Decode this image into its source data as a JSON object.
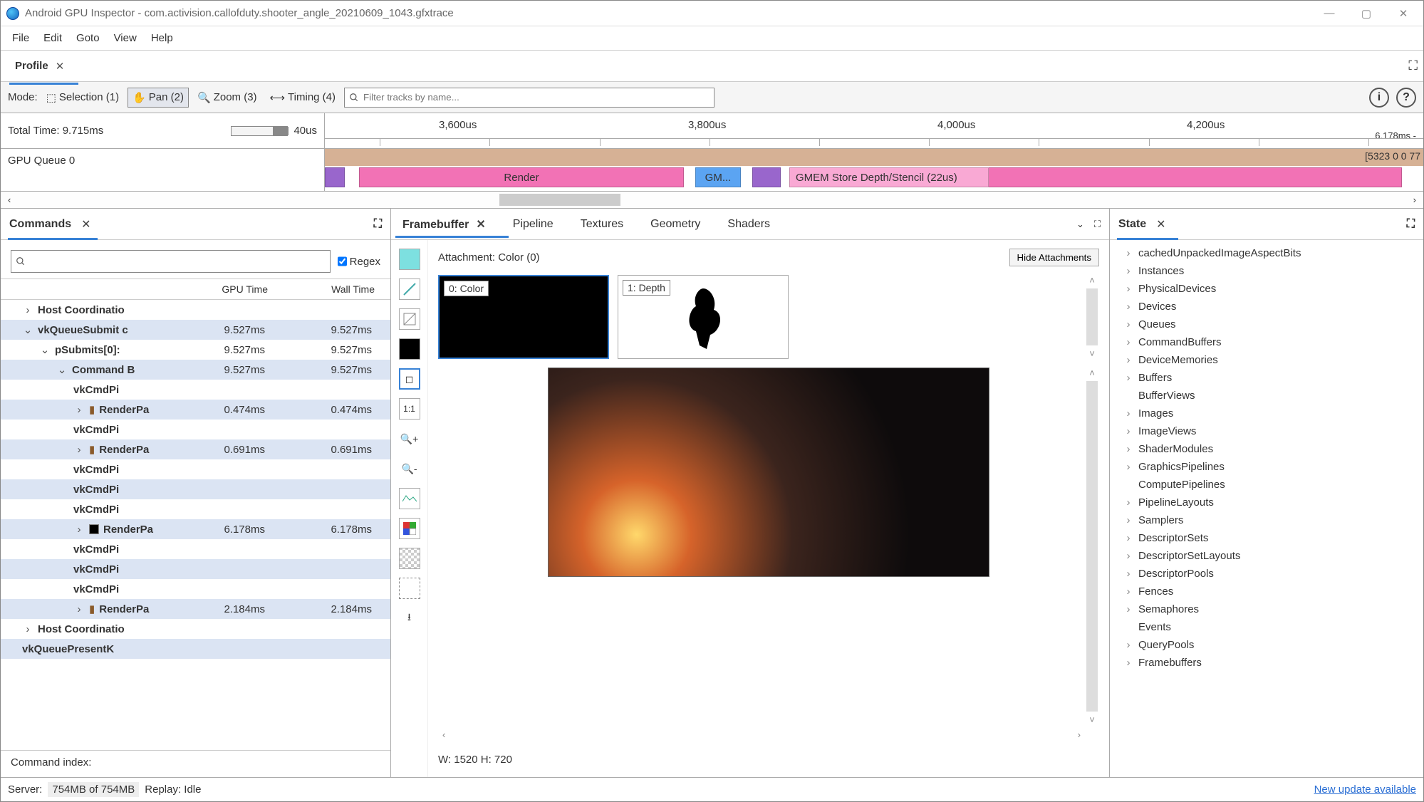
{
  "window": {
    "title": "Android GPU Inspector - com.activision.callofduty.shooter_angle_20210609_1043.gfxtrace"
  },
  "menu": [
    "File",
    "Edit",
    "Goto",
    "View",
    "Help"
  ],
  "main_tab": {
    "label": "Profile"
  },
  "toolbar": {
    "mode_label": "Mode:",
    "selection": "Selection (1)",
    "pan": "Pan (2)",
    "zoom": "Zoom (3)",
    "timing": "Timing (4)",
    "filter_placeholder": "Filter tracks by name..."
  },
  "timeline": {
    "total_time": "Total Time: 9.715ms",
    "left_label": "40us",
    "ticks": [
      "3,600us",
      "3,800us",
      "4,000us",
      "4,200us"
    ],
    "end_label": "6.178ms -"
  },
  "tracks": {
    "label": "GPU Queue 0",
    "right_text": "[5323 0 0 77",
    "blocks": {
      "render": "Render",
      "gm": "GM...",
      "store": "GMEM Store Depth/Stencil (22us)"
    }
  },
  "commands_panel": {
    "title": "Commands",
    "regex": "Regex",
    "columns": [
      "GPU Time",
      "Wall Time"
    ],
    "rows": [
      {
        "indent": 30,
        "chev": "›",
        "bold": true,
        "label": "Host Coordinatio",
        "gpu": "",
        "wall": "",
        "sel": false
      },
      {
        "indent": 30,
        "chev": "⌄",
        "bold": true,
        "label": "vkQueueSubmit c",
        "gpu": "9.527ms",
        "wall": "9.527ms",
        "sel": true
      },
      {
        "indent": 54,
        "chev": "⌄",
        "bold": true,
        "label": "pSubmits[0]:",
        "gpu": "9.527ms",
        "wall": "9.527ms",
        "sel": false
      },
      {
        "indent": 78,
        "chev": "⌄",
        "bold": true,
        "label": "Command B",
        "gpu": "9.527ms",
        "wall": "9.527ms",
        "sel": true
      },
      {
        "indent": 102,
        "chev": "",
        "bold": true,
        "label": "vkCmdPi",
        "gpu": "",
        "wall": "",
        "sel": false
      },
      {
        "indent": 102,
        "chev": "›",
        "icon": "rp",
        "bold": true,
        "label": "RenderPa",
        "gpu": "0.474ms",
        "wall": "0.474ms",
        "sel": true
      },
      {
        "indent": 102,
        "chev": "",
        "bold": true,
        "label": "vkCmdPi",
        "gpu": "",
        "wall": "",
        "sel": false
      },
      {
        "indent": 102,
        "chev": "›",
        "icon": "rp",
        "bold": true,
        "label": "RenderPa",
        "gpu": "0.691ms",
        "wall": "0.691ms",
        "sel": true
      },
      {
        "indent": 102,
        "chev": "",
        "bold": true,
        "label": "vkCmdPi",
        "gpu": "",
        "wall": "",
        "sel": false
      },
      {
        "indent": 102,
        "chev": "",
        "bold": true,
        "label": "vkCmdPi",
        "gpu": "",
        "wall": "",
        "sel": true
      },
      {
        "indent": 102,
        "chev": "",
        "bold": true,
        "label": "vkCmdPi",
        "gpu": "",
        "wall": "",
        "sel": false
      },
      {
        "indent": 102,
        "chev": "›",
        "swatch": "#000",
        "bold": true,
        "label": "RenderPa",
        "gpu": "6.178ms",
        "wall": "6.178ms",
        "sel": true
      },
      {
        "indent": 102,
        "chev": "",
        "bold": true,
        "label": "vkCmdPi",
        "gpu": "",
        "wall": "",
        "sel": false
      },
      {
        "indent": 102,
        "chev": "",
        "bold": true,
        "label": "vkCmdPi",
        "gpu": "",
        "wall": "",
        "sel": true
      },
      {
        "indent": 102,
        "chev": "",
        "bold": true,
        "label": "vkCmdPi",
        "gpu": "",
        "wall": "",
        "sel": false
      },
      {
        "indent": 102,
        "chev": "›",
        "icon": "rp",
        "bold": true,
        "label": "RenderPa",
        "gpu": "2.184ms",
        "wall": "2.184ms",
        "sel": true
      },
      {
        "indent": 30,
        "chev": "›",
        "bold": true,
        "label": "Host Coordinatio",
        "gpu": "",
        "wall": "",
        "sel": false
      },
      {
        "indent": 30,
        "chev": "",
        "bold": true,
        "label": "vkQueuePresentK",
        "gpu": "",
        "wall": "",
        "sel": true
      }
    ],
    "footer": "Command index:"
  },
  "center": {
    "tabs": [
      "Framebuffer",
      "Pipeline",
      "Textures",
      "Geometry",
      "Shaders"
    ],
    "attachment": "Attachment: Color (0)",
    "hide_btn": "Hide Attachments",
    "thumb0": "0: Color",
    "thumb1": "1: Depth",
    "dims": "W: 1520 H: 720"
  },
  "state": {
    "title": "State",
    "items": [
      {
        "label": "cachedUnpackedImageAspectBits",
        "chev": true
      },
      {
        "label": "Instances",
        "chev": true
      },
      {
        "label": "PhysicalDevices",
        "chev": true
      },
      {
        "label": "Devices",
        "chev": true
      },
      {
        "label": "Queues",
        "chev": true
      },
      {
        "label": "CommandBuffers",
        "chev": true
      },
      {
        "label": "DeviceMemories",
        "chev": true
      },
      {
        "label": "Buffers",
        "chev": true
      },
      {
        "label": "BufferViews",
        "chev": false
      },
      {
        "label": "Images",
        "chev": true
      },
      {
        "label": "ImageViews",
        "chev": true
      },
      {
        "label": "ShaderModules",
        "chev": true
      },
      {
        "label": "GraphicsPipelines",
        "chev": true
      },
      {
        "label": "ComputePipelines",
        "chev": false
      },
      {
        "label": "PipelineLayouts",
        "chev": true
      },
      {
        "label": "Samplers",
        "chev": true
      },
      {
        "label": "DescriptorSets",
        "chev": true
      },
      {
        "label": "DescriptorSetLayouts",
        "chev": true
      },
      {
        "label": "DescriptorPools",
        "chev": true
      },
      {
        "label": "Fences",
        "chev": true
      },
      {
        "label": "Semaphores",
        "chev": true
      },
      {
        "label": "Events",
        "chev": false
      },
      {
        "label": "QueryPools",
        "chev": true
      },
      {
        "label": "Framebuffers",
        "chev": true
      }
    ]
  },
  "status": {
    "server_label": "Server:",
    "server_value": "754MB of 754MB",
    "replay": "Replay: Idle",
    "update": "New update available"
  }
}
